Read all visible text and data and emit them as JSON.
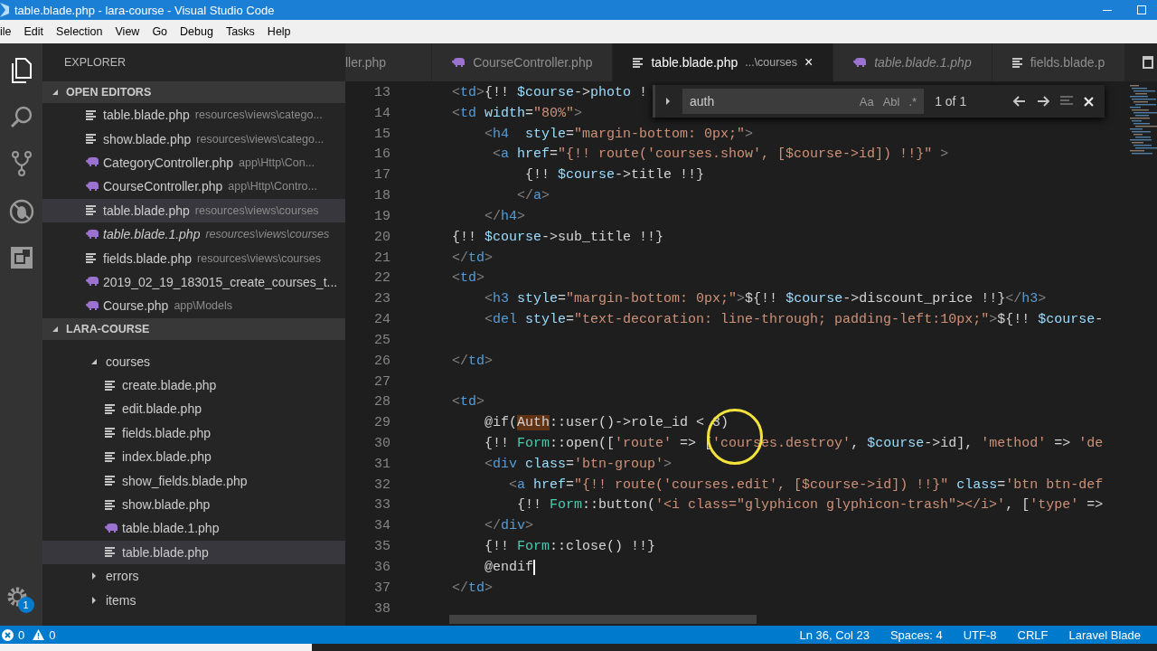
{
  "window": {
    "title": "table.blade.php - lara-course - Visual Studio Code"
  },
  "menu": [
    "ile",
    "Edit",
    "Selection",
    "View",
    "Go",
    "Debug",
    "Tasks",
    "Help"
  ],
  "sidebar": {
    "title": "EXPLORER",
    "open_editors": {
      "title": "OPEN EDITORS",
      "items": [
        {
          "name": "table.blade.php",
          "path": "resources\\views\\catego...",
          "kind": "blade",
          "preview": false,
          "selected": false
        },
        {
          "name": "show.blade.php",
          "path": "resources\\views\\catego...",
          "kind": "blade",
          "preview": false,
          "selected": false
        },
        {
          "name": "CategoryController.php",
          "path": "app\\Http\\Con...",
          "kind": "php",
          "preview": false,
          "selected": false
        },
        {
          "name": "CourseController.php",
          "path": "app\\Http\\Contro...",
          "kind": "php",
          "preview": false,
          "selected": false
        },
        {
          "name": "table.blade.php",
          "path": "resources\\views\\courses",
          "kind": "blade",
          "preview": false,
          "selected": true
        },
        {
          "name": "table.blade.1.php",
          "path": "resources\\views\\courses",
          "kind": "php",
          "preview": true,
          "selected": false
        },
        {
          "name": "fields.blade.php",
          "path": "resources\\views\\courses",
          "kind": "blade",
          "preview": false,
          "selected": false
        },
        {
          "name": "2019_02_19_183015_create_courses_t...",
          "kind": "php",
          "preview": false,
          "selected": false
        },
        {
          "name": "Course.php",
          "path": "app\\Models",
          "kind": "php",
          "preview": false,
          "selected": false
        }
      ]
    },
    "project": {
      "title": "LARA-COURSE",
      "tree": [
        {
          "name": "courses",
          "kind": "folder",
          "expanded": true,
          "children": [
            {
              "name": "create.blade.php",
              "kind": "blade",
              "selected": false
            },
            {
              "name": "edit.blade.php",
              "kind": "blade",
              "selected": false
            },
            {
              "name": "fields.blade.php",
              "kind": "blade",
              "selected": false
            },
            {
              "name": "index.blade.php",
              "kind": "blade",
              "selected": false
            },
            {
              "name": "show_fields.blade.php",
              "kind": "blade",
              "selected": false
            },
            {
              "name": "show.blade.php",
              "kind": "blade",
              "selected": false
            },
            {
              "name": "table.blade.1.php",
              "kind": "php",
              "selected": false
            },
            {
              "name": "table.blade.php",
              "kind": "blade",
              "selected": true
            }
          ]
        },
        {
          "name": "errors",
          "kind": "folder",
          "expanded": false
        },
        {
          "name": "items",
          "kind": "folder",
          "expanded": false
        }
      ]
    }
  },
  "activity_bar": {
    "badge": "1"
  },
  "tabs": [
    {
      "label": "ller.php",
      "kind": "plain",
      "selected": false,
      "preview": false
    },
    {
      "label": "CourseController.php",
      "kind": "php",
      "selected": false,
      "preview": false
    },
    {
      "label": "table.blade.php",
      "description": "...\\courses",
      "close": "×",
      "kind": "blade",
      "selected": true,
      "preview": false
    },
    {
      "label": "table.blade.1.php",
      "kind": "php",
      "selected": false,
      "preview": true
    },
    {
      "label": "fields.blade.p",
      "kind": "blade",
      "selected": false,
      "preview": false
    }
  ],
  "find": {
    "value": "auth",
    "options": [
      "Aa",
      "Abl",
      ".*"
    ],
    "count": "1 of 1"
  },
  "code": [
    {
      "n": "13",
      "tokens": [
        {
          "kind": "p",
          "text": "    <"
        },
        {
          "kind": "tag",
          "text": "td"
        },
        {
          "kind": "p",
          "text": ">"
        },
        {
          "kind": "txt",
          "text": "{!! "
        },
        {
          "kind": "var",
          "text": "$course"
        },
        {
          "kind": "txt",
          "text": "->"
        },
        {
          "kind": "var",
          "text": "photo"
        },
        {
          "kind": "txt",
          "text": " !"
        }
      ]
    },
    {
      "n": "14",
      "tokens": [
        {
          "kind": "p",
          "text": "    <"
        },
        {
          "kind": "tag",
          "text": "td"
        },
        {
          "kind": "attr",
          "text": " width"
        },
        {
          "kind": "txt",
          "text": "="
        },
        {
          "kind": "str",
          "text": "\"80%\""
        },
        {
          "kind": "p",
          "text": ">"
        }
      ]
    },
    {
      "n": "15",
      "tokens": [
        {
          "kind": "p",
          "text": "        <"
        },
        {
          "kind": "tag",
          "text": "h4"
        },
        {
          "kind": "attr",
          "text": "  style"
        },
        {
          "kind": "txt",
          "text": "="
        },
        {
          "kind": "str",
          "text": "\"margin-bottom: 0px;\""
        },
        {
          "kind": "p",
          "text": ">"
        }
      ]
    },
    {
      "n": "16",
      "tokens": [
        {
          "kind": "p",
          "text": "         <"
        },
        {
          "kind": "tag",
          "text": "a"
        },
        {
          "kind": "attr",
          "text": " href"
        },
        {
          "kind": "txt",
          "text": "="
        },
        {
          "kind": "str",
          "text": "\"{!! route('courses.show', [$course->id]) !!}\""
        },
        {
          "kind": "p",
          "text": " >"
        }
      ]
    },
    {
      "n": "17",
      "tokens": [
        {
          "kind": "txt",
          "text": "             {!! "
        },
        {
          "kind": "var",
          "text": "$course"
        },
        {
          "kind": "txt",
          "text": "->title !!}"
        }
      ]
    },
    {
      "n": "18",
      "tokens": [
        {
          "kind": "p",
          "text": "            </"
        },
        {
          "kind": "tag",
          "text": "a"
        },
        {
          "kind": "p",
          "text": ">"
        }
      ]
    },
    {
      "n": "19",
      "tokens": [
        {
          "kind": "p",
          "text": "        </"
        },
        {
          "kind": "tag",
          "text": "h4"
        },
        {
          "kind": "p",
          "text": ">"
        }
      ]
    },
    {
      "n": "20",
      "tokens": [
        {
          "kind": "txt",
          "text": "    {!! "
        },
        {
          "kind": "var",
          "text": "$course"
        },
        {
          "kind": "txt",
          "text": "->sub_title !!}"
        }
      ]
    },
    {
      "n": "21",
      "tokens": [
        {
          "kind": "p",
          "text": "    </"
        },
        {
          "kind": "tag",
          "text": "td"
        },
        {
          "kind": "p",
          "text": ">"
        }
      ]
    },
    {
      "n": "22",
      "tokens": [
        {
          "kind": "p",
          "text": "    <"
        },
        {
          "kind": "tag",
          "text": "td"
        },
        {
          "kind": "p",
          "text": ">"
        }
      ]
    },
    {
      "n": "23",
      "tokens": [
        {
          "kind": "p",
          "text": "        <"
        },
        {
          "kind": "tag",
          "text": "h3"
        },
        {
          "kind": "attr",
          "text": " style"
        },
        {
          "kind": "txt",
          "text": "="
        },
        {
          "kind": "str",
          "text": "\"margin-bottom: 0px;\""
        },
        {
          "kind": "p",
          "text": ">"
        },
        {
          "kind": "txt",
          "text": "${!! "
        },
        {
          "kind": "var",
          "text": "$course"
        },
        {
          "kind": "txt",
          "text": "->discount_price !!}"
        },
        {
          "kind": "p",
          "text": "</"
        },
        {
          "kind": "tag",
          "text": "h3"
        },
        {
          "kind": "p",
          "text": ">"
        }
      ]
    },
    {
      "n": "24",
      "tokens": [
        {
          "kind": "p",
          "text": "        <"
        },
        {
          "kind": "tag",
          "text": "del"
        },
        {
          "kind": "attr",
          "text": " style"
        },
        {
          "kind": "txt",
          "text": "="
        },
        {
          "kind": "str",
          "text": "\"text-decoration: line-through; padding-left:10px;\""
        },
        {
          "kind": "p",
          "text": ">"
        },
        {
          "kind": "txt",
          "text": "${!! "
        },
        {
          "kind": "var",
          "text": "$course"
        },
        {
          "kind": "txt",
          "text": "-"
        }
      ]
    },
    {
      "n": "25"
    },
    {
      "n": "26",
      "tokens": [
        {
          "kind": "p",
          "text": "    </"
        },
        {
          "kind": "tag",
          "text": "td"
        },
        {
          "kind": "p",
          "text": ">"
        }
      ]
    },
    {
      "n": "27"
    },
    {
      "n": "28",
      "tokens": [
        {
          "kind": "p",
          "text": "    <"
        },
        {
          "kind": "tag",
          "text": "td"
        },
        {
          "kind": "p",
          "text": ">"
        }
      ]
    },
    {
      "n": "29",
      "tokens": [
        {
          "kind": "txt",
          "text": "        @if("
        },
        {
          "kind": "match",
          "text": "Auth"
        },
        {
          "kind": "txt",
          "text": "::user()->role_id < 3)"
        }
      ]
    },
    {
      "n": "30",
      "tokens": [
        {
          "kind": "txt",
          "text": "        {!! "
        },
        {
          "kind": "cls",
          "text": "Form"
        },
        {
          "kind": "txt",
          "text": "::open(["
        },
        {
          "kind": "str",
          "text": "'route'"
        },
        {
          "kind": "txt",
          "text": " => ["
        },
        {
          "kind": "str",
          "text": "'courses.destroy'"
        },
        {
          "kind": "txt",
          "text": ", "
        },
        {
          "kind": "var",
          "text": "$course"
        },
        {
          "kind": "txt",
          "text": "->id], "
        },
        {
          "kind": "str",
          "text": "'method'"
        },
        {
          "kind": "txt",
          "text": " => "
        },
        {
          "kind": "str",
          "text": "'de"
        }
      ]
    },
    {
      "n": "31",
      "tokens": [
        {
          "kind": "p",
          "text": "        <"
        },
        {
          "kind": "tag",
          "text": "div"
        },
        {
          "kind": "attr",
          "text": " class"
        },
        {
          "kind": "txt",
          "text": "="
        },
        {
          "kind": "str",
          "text": "'btn-group'"
        },
        {
          "kind": "p",
          "text": ">"
        }
      ]
    },
    {
      "n": "32",
      "tokens": [
        {
          "kind": "p",
          "text": "           <"
        },
        {
          "kind": "tag",
          "text": "a"
        },
        {
          "kind": "attr",
          "text": " href"
        },
        {
          "kind": "txt",
          "text": "="
        },
        {
          "kind": "str",
          "text": "\"{!! route('courses.edit', [$course->id]) !!}\""
        },
        {
          "kind": "attr",
          "text": " class"
        },
        {
          "kind": "txt",
          "text": "="
        },
        {
          "kind": "str",
          "text": "'btn btn-def"
        }
      ]
    },
    {
      "n": "33",
      "tokens": [
        {
          "kind": "txt",
          "text": "            {!! "
        },
        {
          "kind": "cls",
          "text": "Form"
        },
        {
          "kind": "txt",
          "text": "::button("
        },
        {
          "kind": "str",
          "text": "'<i class=\"glyphicon glyphicon-trash\"></i>'"
        },
        {
          "kind": "txt",
          "text": ", ["
        },
        {
          "kind": "str",
          "text": "'type'"
        },
        {
          "kind": "txt",
          "text": " =>"
        }
      ]
    },
    {
      "n": "34",
      "tokens": [
        {
          "kind": "p",
          "text": "        </"
        },
        {
          "kind": "tag",
          "text": "div"
        },
        {
          "kind": "p",
          "text": ">"
        }
      ]
    },
    {
      "n": "35",
      "tokens": [
        {
          "kind": "txt",
          "text": "        {!! "
        },
        {
          "kind": "cls",
          "text": "Form"
        },
        {
          "kind": "txt",
          "text": "::close() !!}"
        }
      ]
    },
    {
      "n": "36",
      "caret": true,
      "tokens": [
        {
          "kind": "txt",
          "text": "        @endif"
        }
      ]
    },
    {
      "n": "37",
      "tokens": [
        {
          "kind": "p",
          "text": "    </"
        },
        {
          "kind": "tag",
          "text": "td"
        },
        {
          "kind": "p",
          "text": ">"
        }
      ]
    },
    {
      "n": "38"
    }
  ],
  "status_bar": {
    "errors": "0",
    "warnings": "0",
    "items": [
      "Ln 36, Col 23",
      "Spaces: 4",
      "UTF-8",
      "CRLF",
      "Laravel Blade"
    ]
  }
}
